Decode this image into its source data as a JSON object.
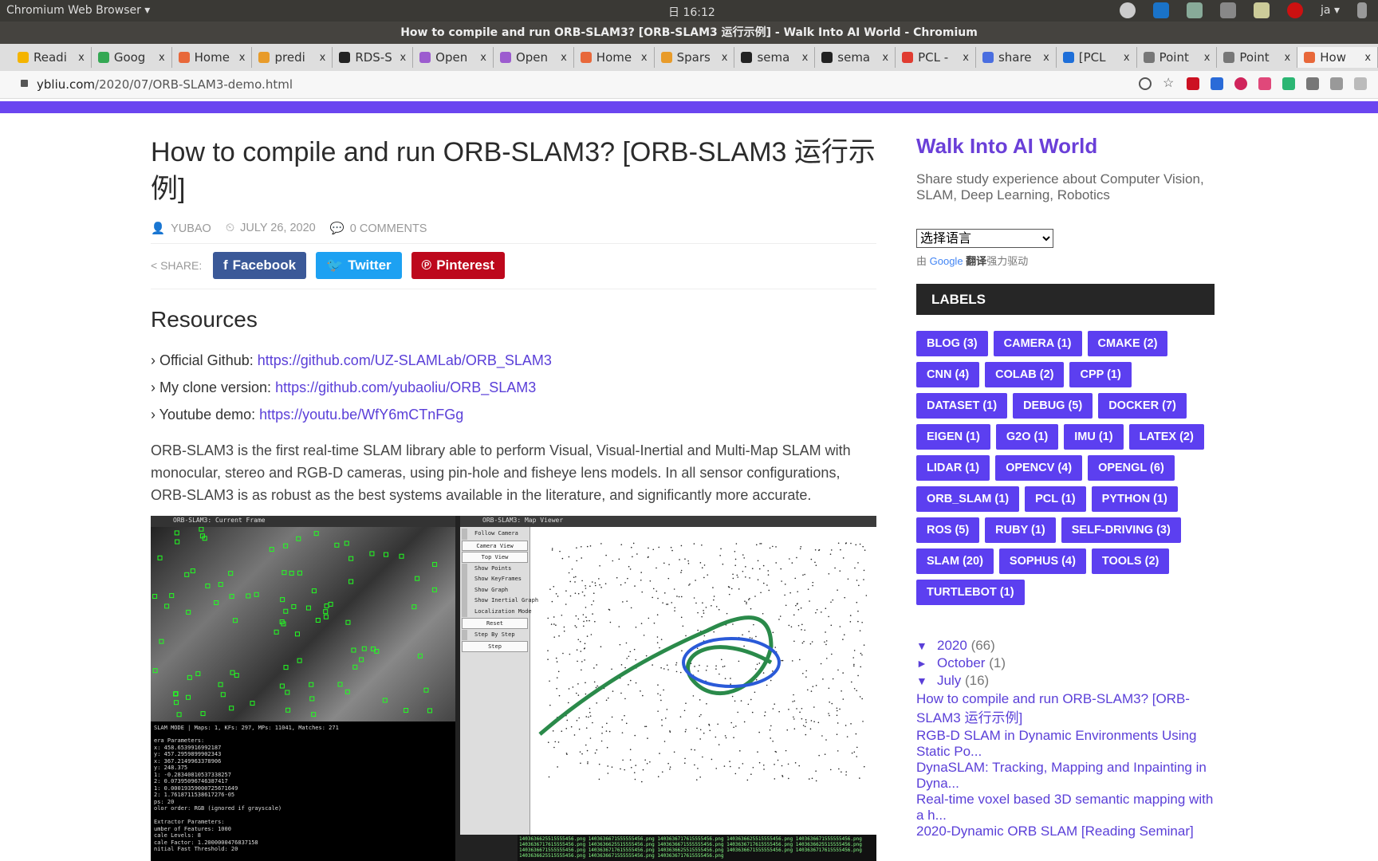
{
  "os": {
    "app": "Chromium Web Browser ▾",
    "clock": "日 16:12",
    "lang": "ja ▾"
  },
  "window_title": "How to compile and run ORB-SLAM3? [ORB-SLAM3 运行示例] - Walk Into AI World - Chromium",
  "tabs": [
    {
      "label": "Readi",
      "color": "#f4b400"
    },
    {
      "label": "Goog",
      "color": "#34a853"
    },
    {
      "label": "Home",
      "color": "#e8683a"
    },
    {
      "label": "predi",
      "color": "#e89b2a"
    },
    {
      "label": "RDS-S",
      "color": "#222222"
    },
    {
      "label": "Open",
      "color": "#9c5ccf"
    },
    {
      "label": "Open",
      "color": "#9c5ccf"
    },
    {
      "label": "Home",
      "color": "#e8683a"
    },
    {
      "label": "Spars",
      "color": "#e89b2a"
    },
    {
      "label": "sema",
      "color": "#222222"
    },
    {
      "label": "sema",
      "color": "#222222"
    },
    {
      "label": "PCL -",
      "color": "#e03c31"
    },
    {
      "label": "share",
      "color": "#4a6ee0"
    },
    {
      "label": "[PCL",
      "color": "#1e6fd9"
    },
    {
      "label": "Point",
      "color": "#777777"
    },
    {
      "label": "Point",
      "color": "#777777"
    },
    {
      "label": "How",
      "color": "#e8683a",
      "active": true
    }
  ],
  "address": {
    "domain": "ybliu.com",
    "path": "/2020/07/ORB-SLAM3-demo.html"
  },
  "article": {
    "title": "How to compile and run ORB-SLAM3? [ORB-SLAM3 运行示例]",
    "author": "YUBAO",
    "date": "JULY 26, 2020",
    "comments": "0 COMMENTS",
    "share_label": "SHARE:",
    "share": [
      {
        "label": "Facebook",
        "icon": "f",
        "color": "#3b5998"
      },
      {
        "label": "Twitter",
        "icon": "🐦",
        "color": "#1da1f2"
      },
      {
        "label": "Pinterest",
        "icon": "℗",
        "color": "#bd081c"
      }
    ],
    "section": "Resources",
    "links": [
      {
        "label": "Official Github: ",
        "url": "https://github.com/UZ-SLAMLab/ORB_SLAM3"
      },
      {
        "label": "My clone version: ",
        "url": "https://github.com/yubaoliu/ORB_SLAM3"
      },
      {
        "label": "Youtube demo: ",
        "url": "https://youtu.be/WfY6mCTnFGg"
      }
    ],
    "paragraph": "ORB-SLAM3 is the first real-time SLAM library able to perform Visual, Visual-Inertial and Multi-Map SLAM with monocular, stereo and RGB-D cameras, using pin-hole and fisheye lens models. In all sensor configurations, ORB-SLAM3 is as robust as the best systems available in the literature, and significantly more accurate.",
    "screenshot": {
      "current_frame_title": "ORB-SLAM3: Current Frame",
      "map_viewer_title": "ORB-SLAM3: Map Viewer",
      "status": "SLAM MODE |  Maps: 1, KFs: 297, MPs: 11041, Matches: 271",
      "menu": [
        {
          "label": "Follow Camera",
          "type": "check"
        },
        {
          "label": "Camera View",
          "type": "button"
        },
        {
          "label": "Top View",
          "type": "button"
        },
        {
          "label": "Show Points",
          "type": "check"
        },
        {
          "label": "Show KeyFrames",
          "type": "check"
        },
        {
          "label": "Show Graph",
          "type": "check"
        },
        {
          "label": "Show Inertial Graph",
          "type": "check"
        },
        {
          "label": "Localization Mode",
          "type": "check"
        },
        {
          "label": "Reset",
          "type": "button"
        },
        {
          "label": "Step By Step",
          "type": "check"
        },
        {
          "label": "Step",
          "type": "button"
        }
      ],
      "terminal_lines": [
        "era Parameters:",
        "x: 458.6539916992187",
        "y: 457.2959899902343",
        "x: 367.2149963378906",
        "y: 248.375",
        "1: -0.28340810537338257",
        "2: 0.07395096746387417",
        "1: 0.00019359000725671649",
        "2: 1.7618711538617276-05",
        "ps: 20",
        "olor order: RGB (ignored if grayscale)",
        "",
        "Extractor Parameters:",
        "umber of Features: 1000",
        "cale Levels: 8",
        "cale Factor: 1.2000000476837158",
        "nitial Fast Threshold: 20"
      ]
    }
  },
  "sidebar": {
    "title": "Walk Into AI World",
    "description": "Share study experience about Computer Vision, SLAM, Deep Learning, Robotics",
    "language_select": "选择语言",
    "powered_prefix": "由 ",
    "powered_google": "Google",
    "powered_translate": "翻译",
    "powered_suffix": "强力驱动",
    "labels_heading": "LABELS",
    "labels": [
      "BLOG (3)",
      "CAMERA (1)",
      "CMAKE (2)",
      "CNN (4)",
      "COLAB (2)",
      "CPP (1)",
      "DATASET (1)",
      "DEBUG (5)",
      "DOCKER (7)",
      "EIGEN (1)",
      "G2O (1)",
      "IMU (1)",
      "LATEX (2)",
      "LIDAR (1)",
      "OPENCV (4)",
      "OPENGL (6)",
      "ORB_SLAM (1)",
      "PCL (1)",
      "PYTHON (1)",
      "ROS (5)",
      "RUBY (1)",
      "SELF-DRIVING (3)",
      "SLAM (20)",
      "SOPHUS (4)",
      "TOOLS (2)",
      "TURTLEBOT (1)"
    ],
    "archive": [
      {
        "tri": "▼",
        "label": "2020",
        "count": "(66)"
      },
      {
        "tri": "►",
        "label": "October",
        "count": "(1)"
      },
      {
        "tri": "▼",
        "label": "July",
        "count": "(16)"
      }
    ],
    "posts": [
      "How to compile and run ORB-SLAM3? [ORB-SLAM3 运行示例]",
      "RGB-D SLAM in Dynamic Environments Using Static Po...",
      "DynaSLAM: Tracking, Mapping and Inpainting in Dyna...",
      "Real-time voxel based 3D semantic mapping with a h...",
      "2020-Dynamic ORB SLAM [Reading Seminar]"
    ]
  },
  "colors": {
    "accent": "#6a45f0",
    "link": "#5a3fd8",
    "label_bg": "#5c3ff0"
  }
}
